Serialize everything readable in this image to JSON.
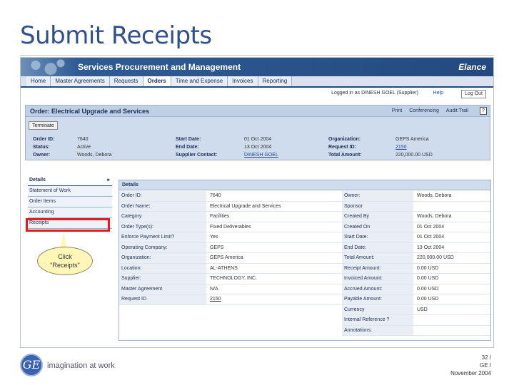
{
  "slide": {
    "title": "Submit Receipts",
    "page_number": "32 /",
    "company": "GE /",
    "date": "November 2004",
    "tagline": "imagination at work",
    "logo_text": "GE"
  },
  "app": {
    "name": "Services Procurement and Management",
    "brand": "Elance",
    "tabs": [
      "Home",
      "Master Agreements",
      "Requests",
      "Orders",
      "Time and Expense",
      "Invoices",
      "Reporting"
    ],
    "active_tab": "Orders",
    "logged_in": "Logged in as DINESH GOEL (Supplier)",
    "help": "Help",
    "logout": "Log Out"
  },
  "order": {
    "title": "Order: Electrical Upgrade and Services",
    "actions": [
      "Print",
      "Conferencing",
      "Audit Trail"
    ],
    "help_icon": "?",
    "terminate": "Terminate",
    "fields": [
      {
        "label": "Order ID:",
        "value": "7640",
        "label2": "Start Date:",
        "value2": "01 Oct 2004",
        "label3": "Organization:",
        "value3": "GEPS America"
      },
      {
        "label": "Status:",
        "value": "Active",
        "label2": "End Date:",
        "value2": "13 Oct 2004",
        "label3": "Request ID:",
        "value3": "2150"
      },
      {
        "label": "Owner:",
        "value": "Woods, Debora",
        "label2": "Supplier Contact:",
        "value2": "DINESH GOEL",
        "label3": "Total Amount:",
        "value3": "220,000.00 USD"
      }
    ]
  },
  "side_nav": {
    "items": [
      "Details",
      "Statement of Work",
      "Order Items",
      "Accounting",
      "Receipts"
    ],
    "expand_arrow": "▸"
  },
  "callout": {
    "line1": "Click",
    "line2": "\"Receipts\""
  },
  "details": {
    "header": "Details",
    "left": [
      {
        "label": "Order ID:",
        "value": "7640"
      },
      {
        "label": "Order Name:",
        "value": "Electrical Upgrade and Services"
      },
      {
        "label": "Category",
        "value": "Facilities"
      },
      {
        "label": "Order Type(s):",
        "value": "Fixed Deliverables"
      },
      {
        "label": "Enforce Payment Limit?",
        "value": "Yes"
      },
      {
        "label": "Operating Company:",
        "value": "GEPS"
      },
      {
        "label": "Organization:",
        "value": "GEPS America"
      },
      {
        "label": "Location:",
        "value": "AL-ATHENS"
      },
      {
        "label": "Supplier:",
        "value": "TECHNOLOGY, INC."
      },
      {
        "label": "Master Agreement",
        "value": "N/A"
      },
      {
        "label": "Request ID",
        "value": "2150"
      }
    ],
    "right": [
      {
        "label": "Owner:",
        "value": "Woods, Debora"
      },
      {
        "label": "Sponsor",
        "value": ""
      },
      {
        "label": "Created By",
        "value": "Woods, Debora"
      },
      {
        "label": "Created On",
        "value": "01 Oct 2004"
      },
      {
        "label": "Start Date:",
        "value": "01 Oct 2004"
      },
      {
        "label": "End Date:",
        "value": "13 Oct 2004"
      },
      {
        "label": "Total Amount:",
        "value": "220,000.00 USD"
      },
      {
        "label": "Receipt Amount:",
        "value": "0.00 USD"
      },
      {
        "label": "Invoiced Amount:",
        "value": "0.00 USD"
      },
      {
        "label": "Accrued Amount:",
        "value": "0.00 USD"
      },
      {
        "label": "Payable Amount:",
        "value": "0.00 USD"
      },
      {
        "label": "Currency",
        "value": "USD"
      },
      {
        "label": "Internal Reference ?",
        "value": ""
      },
      {
        "label": "Annotations:",
        "value": ""
      }
    ]
  }
}
